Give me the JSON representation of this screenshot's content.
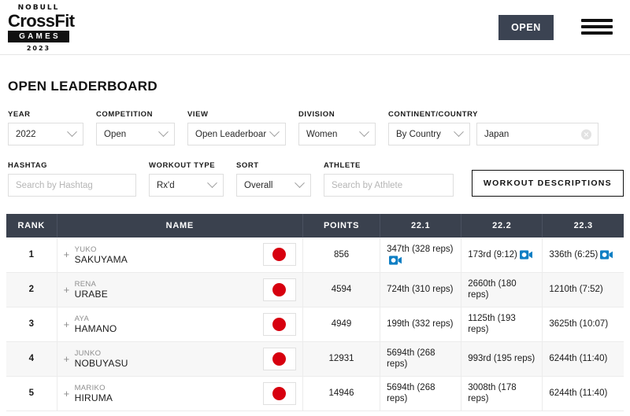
{
  "brand": {
    "nobull": "NOBULL",
    "crossfit": "CrossFit",
    "games": "GAMES",
    "year": "2023"
  },
  "header": {
    "open_button": "OPEN",
    "menu_icon": "hamburger-menu-icon"
  },
  "page": {
    "title": "OPEN LEADERBOARD"
  },
  "filters": {
    "year": {
      "label": "YEAR",
      "value": "2022"
    },
    "competition": {
      "label": "COMPETITION",
      "value": "Open"
    },
    "view": {
      "label": "VIEW",
      "value": "Open Leaderboard"
    },
    "division": {
      "label": "DIVISION",
      "value": "Women"
    },
    "continent_country": {
      "label": "CONTINENT/COUNTRY",
      "value": "By Country"
    },
    "country": {
      "value": "Japan",
      "clear_icon": "clear-circle-icon"
    },
    "hashtag": {
      "label": "HASHTAG",
      "placeholder": "Search by Hashtag",
      "value": ""
    },
    "workout_type": {
      "label": "WORKOUT TYPE",
      "value": "Rx'd"
    },
    "sort": {
      "label": "SORT",
      "value": "Overall"
    },
    "athlete": {
      "label": "ATHLETE",
      "placeholder": "Search by Athlete",
      "value": ""
    },
    "workout_descriptions_button": "WORKOUT DESCRIPTIONS"
  },
  "table": {
    "columns": [
      "RANK",
      "NAME",
      "POINTS",
      "22.1",
      "22.2",
      "22.3"
    ],
    "rows": [
      {
        "rank": "1",
        "first_name": "YUKO",
        "last_name": "SAKUYAMA",
        "flag": "japan-flag",
        "points": "856",
        "w1": "347th (328 reps)",
        "w1_video": true,
        "w2": "173rd (9:12)",
        "w2_video": true,
        "w3": "336th (6:25)",
        "w3_video": true
      },
      {
        "rank": "2",
        "first_name": "RENA",
        "last_name": "URABE",
        "flag": "japan-flag",
        "points": "4594",
        "w1": "724th (310 reps)",
        "w1_video": false,
        "w2": "2660th (180 reps)",
        "w2_video": false,
        "w3": "1210th (7:52)",
        "w3_video": false
      },
      {
        "rank": "3",
        "first_name": "AYA",
        "last_name": "HAMANO",
        "flag": "japan-flag",
        "points": "4949",
        "w1": "199th (332 reps)",
        "w1_video": false,
        "w2": "1125th (193 reps)",
        "w2_video": false,
        "w3": "3625th (10:07)",
        "w3_video": false
      },
      {
        "rank": "4",
        "first_name": "JUNKO",
        "last_name": "NOBUYASU",
        "flag": "japan-flag",
        "points": "12931",
        "w1": "5694th (268 reps)",
        "w1_video": false,
        "w2": "993rd (195 reps)",
        "w2_video": false,
        "w3": "6244th (11:40)",
        "w3_video": false
      },
      {
        "rank": "5",
        "first_name": "MARIKO",
        "last_name": "HIRUMA",
        "flag": "japan-flag",
        "points": "14946",
        "w1": "5694th (268 reps)",
        "w1_video": false,
        "w2": "3008th (178 reps)",
        "w2_video": false,
        "w3": "6244th (11:40)",
        "w3_video": false
      }
    ]
  },
  "colors": {
    "header_bar": "#3a414e",
    "open_button": "#3b4352",
    "video_icon": "#0f7fc4",
    "flag_red": "#d7000f"
  }
}
